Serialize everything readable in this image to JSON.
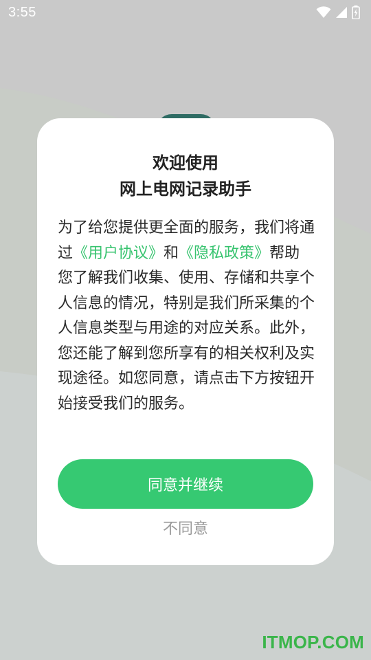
{
  "status_bar": {
    "time": "3:55",
    "icons": [
      "wifi-icon",
      "cellular-signal-icon",
      "battery-charging-icon"
    ]
  },
  "dialog": {
    "title_line1": "欢迎使用",
    "title_line2": "网上电网记录助手",
    "body_part1": "为了给您提供更全面的服务，我们将通过",
    "user_agreement_link": "《用户协议》",
    "body_part2": "和",
    "privacy_policy_link": "《隐私政策》",
    "body_part3": "帮助您了解我们收集、使用、存储和共享个人信息的情况，特别是我们所采集的个人信息类型与用途的对应关系。此外，您还能了解到您所享有的相关权利及实现途径。如您同意，请点击下方按钮开始接受我们的服务。",
    "agree_button_label": "同意并继续",
    "disagree_button_label": "不同意"
  },
  "watermark": {
    "text": "ITMOP.COM"
  },
  "colors": {
    "accent_green": "#36c972",
    "link_green": "#36c36e",
    "overlay_gray": "#c9c9c9",
    "watermark_green": "#3ab54a"
  }
}
